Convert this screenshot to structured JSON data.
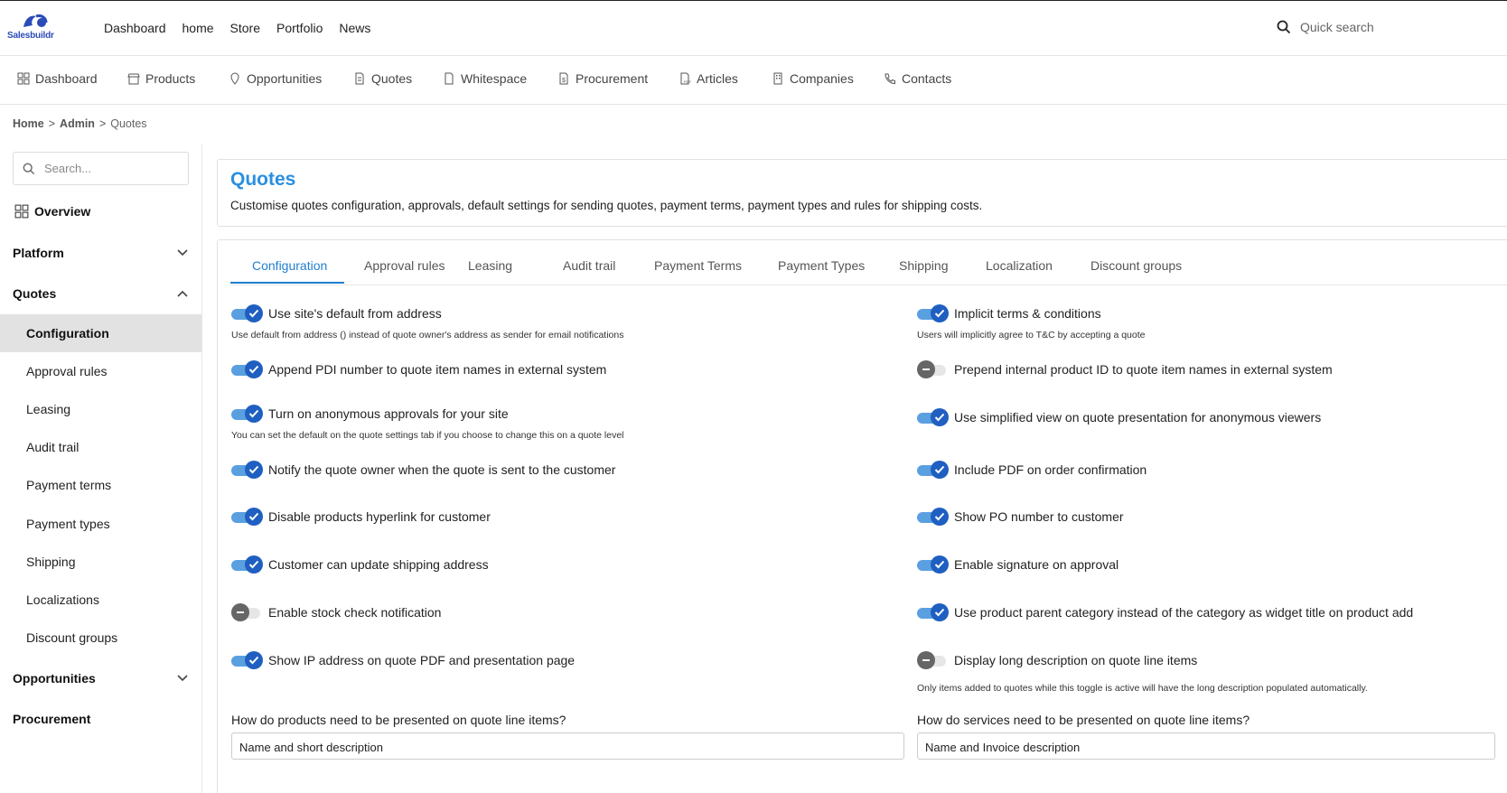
{
  "app": {
    "logo_text": "Salesbuildr"
  },
  "topnav": [
    "Dashboard",
    "home",
    "Store",
    "Portfolio",
    "News"
  ],
  "quick_search": {
    "placeholder": "Quick search"
  },
  "modules": [
    "Dashboard",
    "Products",
    "Opportunities",
    "Quotes",
    "Whitespace",
    "Procurement",
    "Articles",
    "Companies",
    "Contacts"
  ],
  "breadcrumb": {
    "home": "Home",
    "sep": ">",
    "admin": "Admin",
    "current": "Quotes"
  },
  "sidebar": {
    "search_placeholder": "Search...",
    "overview": "Overview",
    "groups": {
      "platform": "Platform",
      "quotes": "Quotes",
      "opportunities": "Opportunities",
      "procurement": "Procurement"
    },
    "quote_items": [
      "Configuration",
      "Approval rules",
      "Leasing",
      "Audit trail",
      "Payment terms",
      "Payment types",
      "Shipping",
      "Localizations",
      "Discount groups"
    ]
  },
  "page": {
    "title": "Quotes",
    "description": "Customise quotes configuration, approvals, default settings for sending quotes, payment terms, payment types and rules for shipping costs."
  },
  "tabs": [
    "Configuration",
    "Approval rules",
    "Leasing",
    "Audit trail",
    "Payment Terms",
    "Payment Types",
    "Shipping",
    "Localization",
    "Discount groups"
  ],
  "settings_left": [
    {
      "label": "Use site's default from address",
      "on": true,
      "desc": "Use default from address () instead of quote owner's address as sender for email notifications"
    },
    {
      "label": "Append PDI number to quote item names in external system",
      "on": true
    },
    {
      "label": "Turn on anonymous approvals for your site",
      "on": true,
      "desc": "You can set the default on the quote settings tab if you choose to change this on a quote level"
    },
    {
      "label": "Notify the quote owner when the quote is sent to the customer",
      "on": true
    },
    {
      "label": "Disable products hyperlink for customer",
      "on": true
    },
    {
      "label": "Customer can update shipping address",
      "on": true
    },
    {
      "label": "Enable stock check notification",
      "on": false
    },
    {
      "label": "Show IP address on quote PDF and presentation page",
      "on": true
    }
  ],
  "settings_right": [
    {
      "label": "Implicit terms & conditions",
      "on": true,
      "desc": "Users will implicitly agree to T&C by accepting a quote"
    },
    {
      "label": "Prepend internal product ID to quote item names in external system",
      "on": false
    },
    {
      "label": "Use simplified view on quote presentation for anonymous viewers",
      "on": true
    },
    {
      "label": "Include PDF on order confirmation",
      "on": true
    },
    {
      "label": "Show PO number to customer",
      "on": true
    },
    {
      "label": "Enable signature on approval",
      "on": true
    },
    {
      "label": "Use product parent category instead of the category as widget title on product add",
      "on": true
    },
    {
      "label": "Display long description on quote line items",
      "on": false,
      "desc": "Only items added to quotes while this toggle is active will have the long description populated automatically."
    }
  ],
  "presentation": {
    "products_label": "How do products need to be presented on quote line items?",
    "products_value": "Name and short description",
    "services_label": "How do services need to be presented on quote line items?",
    "services_value": "Name and Invoice description"
  }
}
